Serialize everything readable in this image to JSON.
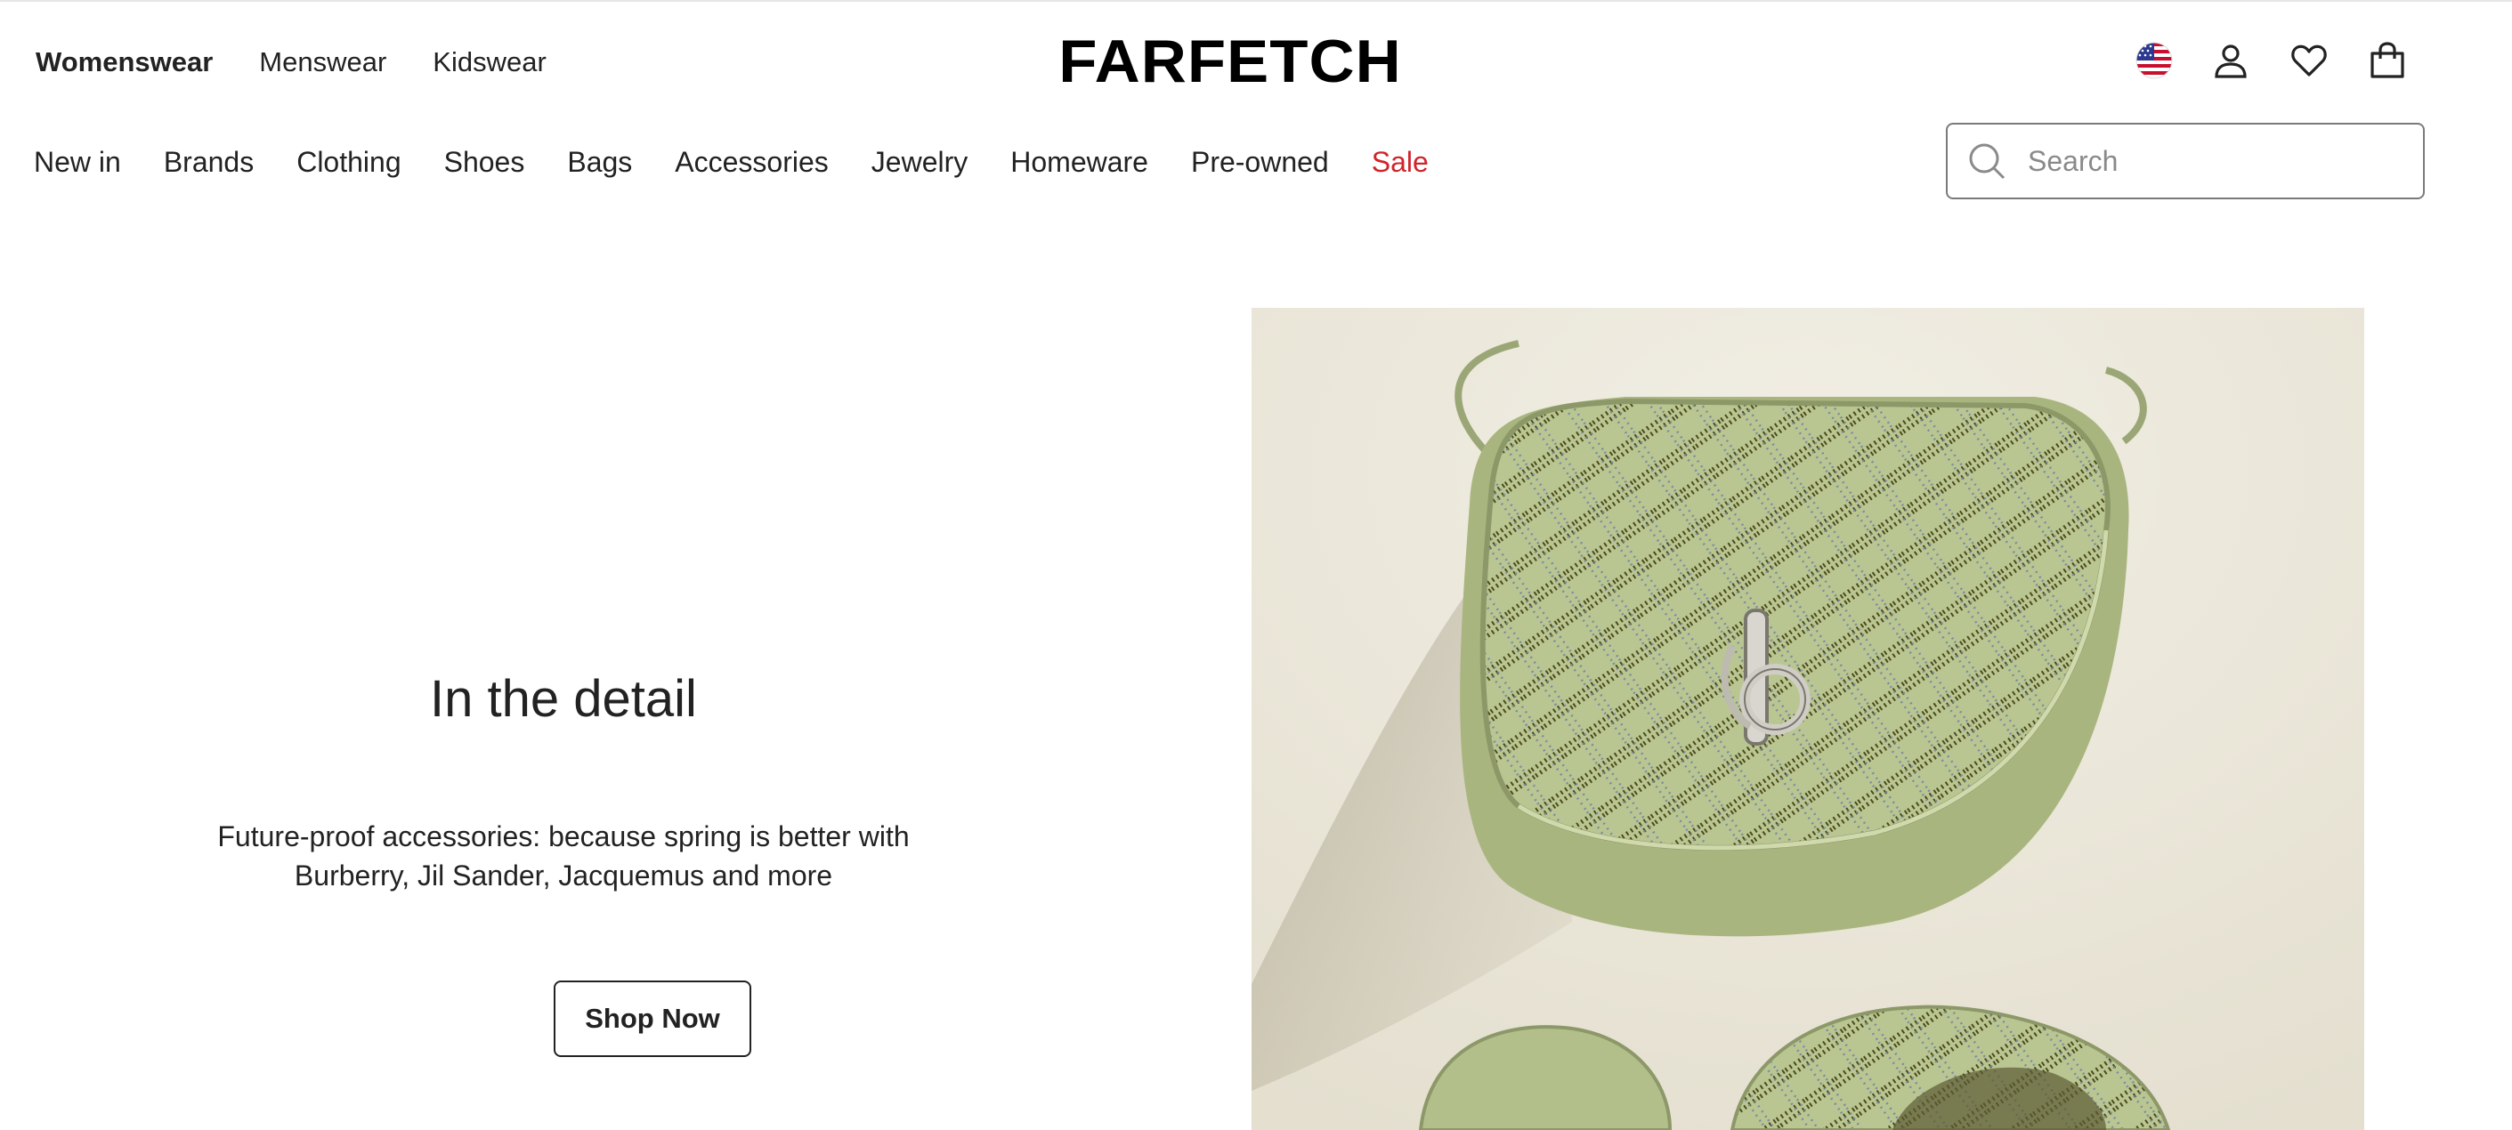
{
  "header": {
    "logo": "FARFETCH",
    "gender_tabs": [
      {
        "label": "Womenswear",
        "active": true
      },
      {
        "label": "Menswear",
        "active": false
      },
      {
        "label": "Kidswear",
        "active": false
      }
    ],
    "icons": [
      "us-flag-icon",
      "account-icon",
      "wishlist-heart-icon",
      "shopping-bag-icon"
    ]
  },
  "nav": {
    "items": [
      "New in",
      "Brands",
      "Clothing",
      "Shoes",
      "Bags",
      "Accessories",
      "Jewelry",
      "Homeware",
      "Pre-owned",
      "Sale"
    ],
    "sale_color": "#d0242b"
  },
  "search": {
    "placeholder": "Search"
  },
  "hero": {
    "title": "In the detail",
    "description": "Future-proof accessories: because spring is better with Burberry, Jil Sander, Jacquemus and more",
    "cta": "Shop Now",
    "image_colors": {
      "background": "#ece8dc",
      "product": "#b7c48f",
      "stud": "#4a4a1c"
    }
  }
}
